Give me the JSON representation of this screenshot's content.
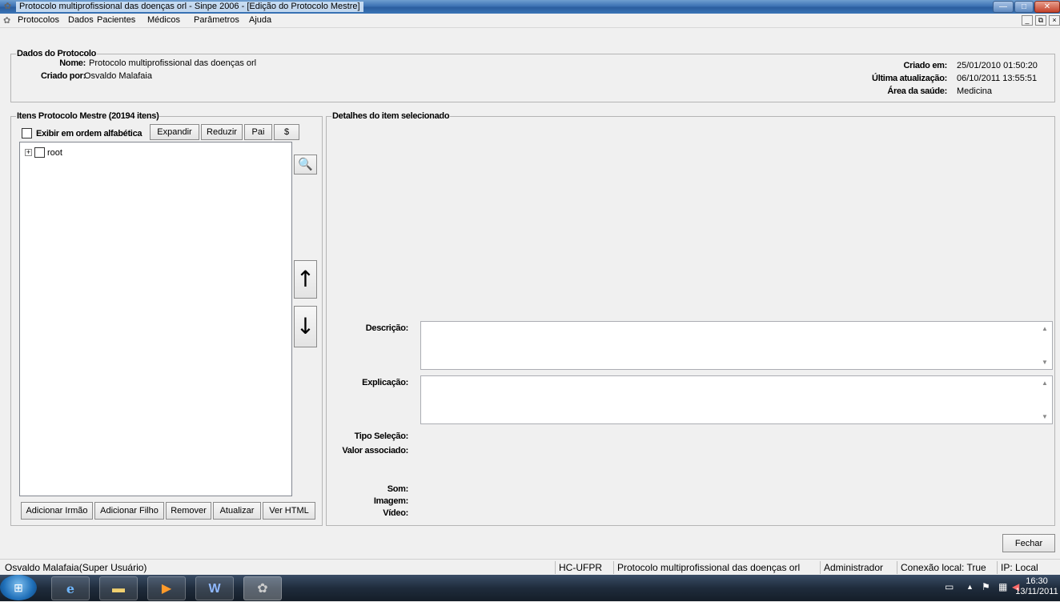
{
  "window": {
    "title": "Protocolo multiprofissional das doenças orl - Sinpe 2006 - [Edição do Protocolo Mestre]"
  },
  "menu": [
    "Protocolos",
    "Dados",
    "Pacientes",
    "Médicos",
    "Parâmetros",
    "Ajuda"
  ],
  "protocol": {
    "legend": "Dados do Protocolo",
    "name_label": "Nome:",
    "name_value": "Protocolo multiprofissional das doenças orl",
    "created_by_label": "Criado por:",
    "created_by_value": "Osvaldo Malafaia",
    "created_at_label": "Criado em:",
    "created_at_value": "25/01/2010 01:50:20",
    "updated_label": "Última atualização:",
    "updated_value": "06/10/2011 13:55:51",
    "area_label": "Área da saúde:",
    "area_value": "Medicina"
  },
  "items": {
    "legend": "Itens Protocolo Mestre (20194 itens)",
    "alpha_label": "Exibir em ordem alfabética",
    "buttons": {
      "expand": "Expandir",
      "reduce": "Reduzir",
      "parent": "Pai",
      "dollar": "$"
    },
    "tree_root": "root",
    "bottom_buttons": {
      "add_sibling": "Adicionar Irmão",
      "add_child": "Adicionar Filho",
      "remove": "Remover",
      "update": "Atualizar",
      "view_html": "Ver HTML"
    }
  },
  "details": {
    "legend": "Detalhes do item selecionado",
    "description_label": "Descrição:",
    "explanation_label": "Explicação:",
    "selection_type_label": "Tipo Seleção:",
    "associated_value_label": "Valor associado:",
    "sound_label": "Som:",
    "image_label": "Imagem:",
    "video_label": "Vídeo:"
  },
  "close_button": "Fechar",
  "status": {
    "user": "Osvaldo Malafaia(Super Usuário)",
    "org": "HC-UFPR",
    "protocol": "Protocolo multiprofissional das doenças orl",
    "role": "Administrador",
    "connection": "Conexão local: True",
    "ip": "IP: Local"
  },
  "clock": {
    "time": "16:30",
    "date": "13/11/2011"
  }
}
